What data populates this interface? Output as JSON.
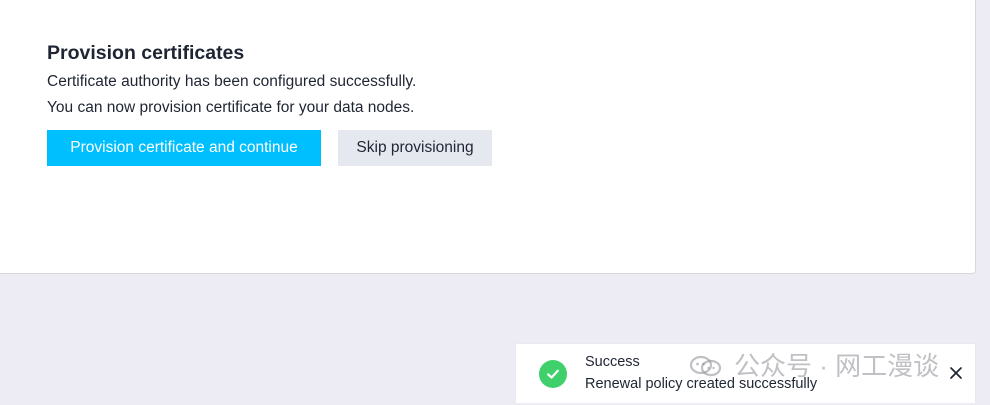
{
  "provision": {
    "title": "Provision certificates",
    "description_line1": "Certificate authority has been configured successfully.",
    "description_line2": "You can now provision certificate for your data nodes.",
    "primary_button": "Provision certificate and continue",
    "secondary_button": "Skip provisioning"
  },
  "toast": {
    "title": "Success",
    "message": "Renewal policy created successfully",
    "icon": "check-circle-icon",
    "close_icon": "close-icon",
    "watermark": "公众号 · 网工漫谈"
  },
  "colors": {
    "page_background": "#edecf5",
    "primary": "#00bfff",
    "secondary": "#e6e8f0",
    "success": "#3fcf6b",
    "text": "#1f2533"
  }
}
